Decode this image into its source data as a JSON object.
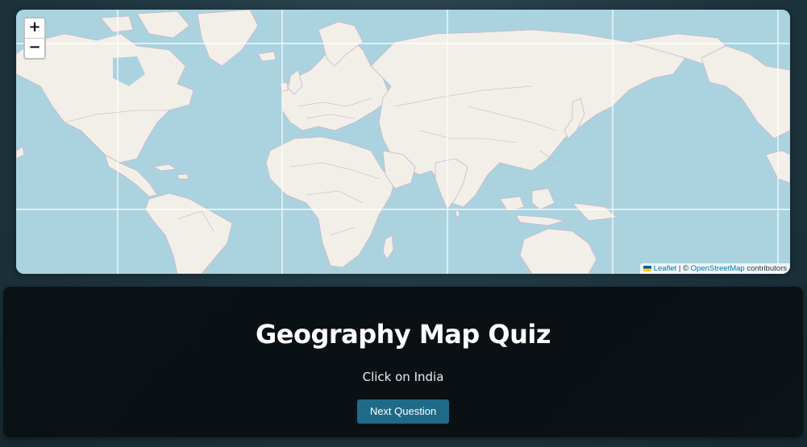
{
  "map": {
    "zoom_in_label": "+",
    "zoom_out_label": "−",
    "attribution": {
      "leaflet_label": "Leaflet",
      "separator": " | © ",
      "osm_label": "OpenStreetMap",
      "suffix": " contributors"
    },
    "colors": {
      "water": "#aad3df",
      "land": "#f2efe9",
      "border": "#c6aebf"
    }
  },
  "quiz": {
    "title": "Geography Map Quiz",
    "prompt": "Click on India",
    "next_button_label": "Next Question",
    "colors": {
      "card_background": "#0a1013",
      "button_background": "#1f6a86"
    }
  }
}
